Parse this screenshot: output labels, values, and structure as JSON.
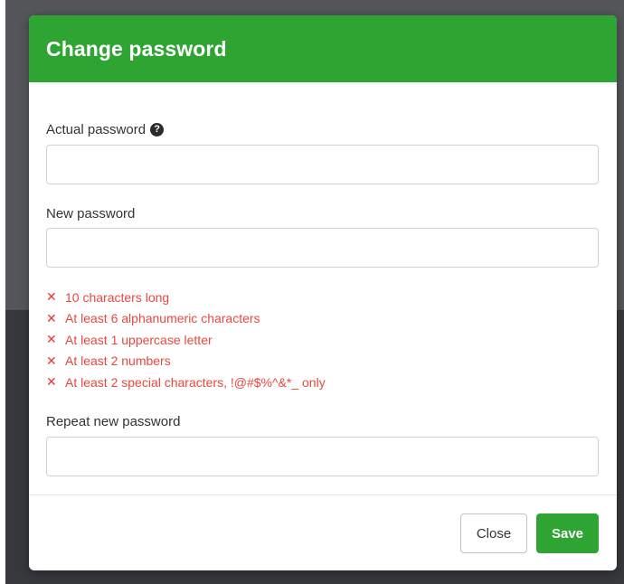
{
  "dialog": {
    "title": "Change password"
  },
  "fields": {
    "actual_password": {
      "label": "Actual password",
      "value": "",
      "help_icon": "question-circle-icon"
    },
    "new_password": {
      "label": "New password",
      "value": ""
    },
    "repeat_new_password": {
      "label": "Repeat new password",
      "value": ""
    }
  },
  "rules": [
    {
      "text": "10 characters long",
      "status": "unmet"
    },
    {
      "text": "At least 6 alphanumeric characters",
      "status": "unmet"
    },
    {
      "text": "At least 1 uppercase letter",
      "status": "unmet"
    },
    {
      "text": "At least 2 numbers",
      "status": "unmet"
    },
    {
      "text": "At least 2 special characters, !@#$%^&*_ only",
      "status": "unmet"
    }
  ],
  "rule_icon": "cross-icon",
  "buttons": {
    "close": "Close",
    "save": "Save"
  },
  "colors": {
    "header": "#2ea533",
    "error": "#e8483f",
    "save_button": "#2ea533"
  }
}
